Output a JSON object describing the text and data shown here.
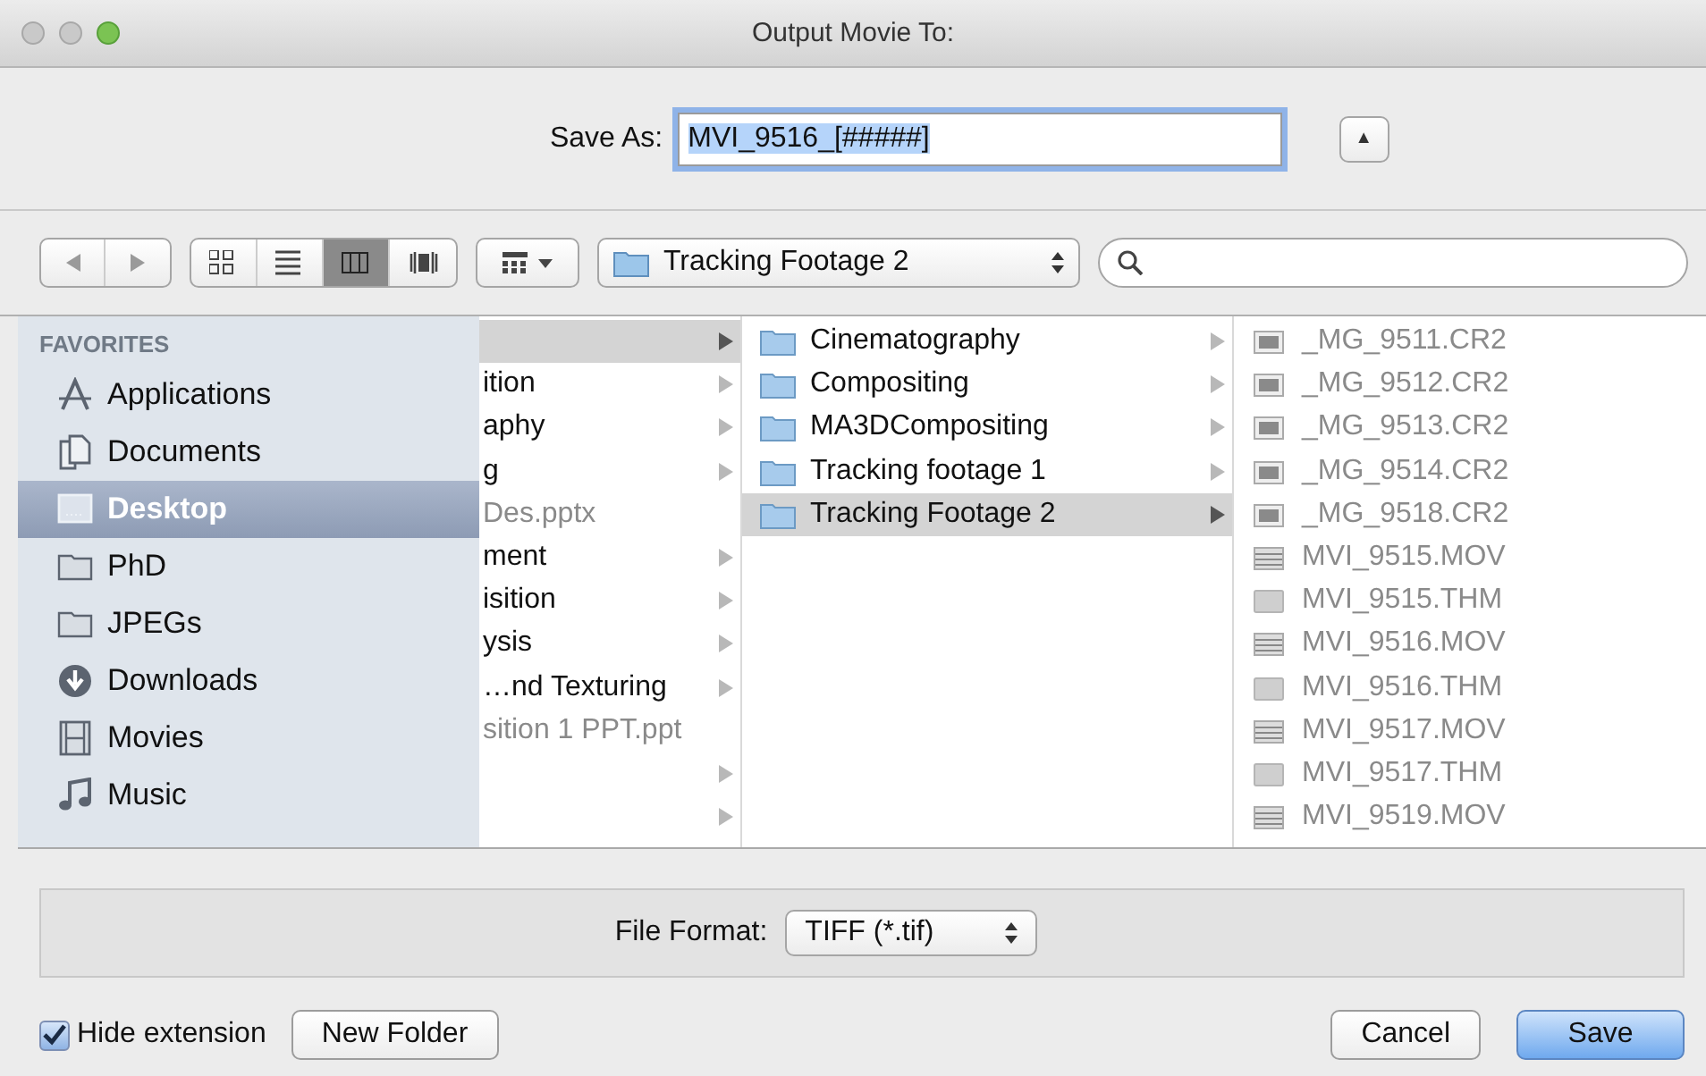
{
  "window": {
    "title": "Output Movie To:"
  },
  "save_as": {
    "label": "Save As:",
    "value": "MVI_9516_[#####]",
    "expand_button": "▲"
  },
  "toolbar": {
    "view_modes": [
      {
        "kind": "icons",
        "selected": false
      },
      {
        "kind": "list",
        "selected": false
      },
      {
        "kind": "columns",
        "selected": true
      },
      {
        "kind": "coverflow",
        "selected": false
      }
    ],
    "location": "Tracking Footage 2"
  },
  "sidebar": {
    "heading": "FAVORITES",
    "items": [
      {
        "label": "Applications",
        "kind": "apps",
        "selected": false
      },
      {
        "label": "Documents",
        "kind": "documents",
        "selected": false
      },
      {
        "label": "Desktop",
        "kind": "desktop",
        "selected": true
      },
      {
        "label": "PhD",
        "kind": "folder",
        "selected": false
      },
      {
        "label": "JPEGs",
        "kind": "folder",
        "selected": false
      },
      {
        "label": "Downloads",
        "kind": "downloads",
        "selected": false
      },
      {
        "label": "Movies",
        "kind": "movies",
        "selected": false
      },
      {
        "label": "Music",
        "kind": "music",
        "selected": false
      }
    ]
  },
  "columns": [
    {
      "items": [
        {
          "has_children": true,
          "selected": true
        },
        {
          "label": "ition",
          "has_children": true,
          "selected": false,
          "disabled": false
        },
        {
          "label": "aphy",
          "has_children": true,
          "selected": false,
          "disabled": false
        },
        {
          "label": "g",
          "has_children": true,
          "selected": false,
          "disabled": false
        },
        {
          "label": "Des.pptx",
          "has_children": false,
          "selected": false,
          "disabled": true
        },
        {
          "label": "ment",
          "has_children": true,
          "selected": false,
          "disabled": false
        },
        {
          "label": "isition",
          "has_children": true,
          "selected": false,
          "disabled": false
        },
        {
          "label": "ysis",
          "has_children": true,
          "selected": false,
          "disabled": false
        },
        {
          "label": "…nd Texturing",
          "has_children": true,
          "selected": false,
          "disabled": false
        },
        {
          "label": "sition 1 PPT.ppt",
          "has_children": false,
          "selected": false,
          "disabled": true
        },
        {
          "has_children": true,
          "selected": false
        },
        {
          "has_children": true,
          "selected": false
        }
      ]
    },
    {
      "items": [
        {
          "label": "Cinematography",
          "kind": "folder",
          "has_children": true,
          "selected": false,
          "disabled": false
        },
        {
          "label": "Compositing",
          "kind": "folder",
          "has_children": true,
          "selected": false,
          "disabled": false
        },
        {
          "label": "MA3DCompositing",
          "kind": "folder",
          "has_children": true,
          "selected": false,
          "disabled": false
        },
        {
          "label": "Tracking footage 1",
          "kind": "folder",
          "has_children": true,
          "selected": false,
          "disabled": false
        },
        {
          "label": "Tracking Footage 2",
          "kind": "folder",
          "has_children": true,
          "selected": true,
          "disabled": false
        }
      ]
    },
    {
      "items": [
        {
          "label": "_MG_9511.CR2",
          "kind": "image",
          "has_children": false,
          "selected": false,
          "disabled": true
        },
        {
          "label": "_MG_9512.CR2",
          "kind": "image",
          "has_children": false,
          "selected": false,
          "disabled": true
        },
        {
          "label": "_MG_9513.CR2",
          "kind": "image",
          "has_children": false,
          "selected": false,
          "disabled": true
        },
        {
          "label": "_MG_9514.CR2",
          "kind": "image",
          "has_children": false,
          "selected": false,
          "disabled": true
        },
        {
          "label": "_MG_9518.CR2",
          "kind": "image",
          "has_children": false,
          "selected": false,
          "disabled": true
        },
        {
          "label": "MVI_9515.MOV",
          "kind": "movie",
          "has_children": false,
          "selected": false,
          "disabled": true
        },
        {
          "label": "MVI_9515.THM",
          "kind": "thumbnail",
          "has_children": false,
          "selected": false,
          "disabled": true
        },
        {
          "label": "MVI_9516.MOV",
          "kind": "movie",
          "has_children": false,
          "selected": false,
          "disabled": true
        },
        {
          "label": "MVI_9516.THM",
          "kind": "thumbnail",
          "has_children": false,
          "selected": false,
          "disabled": true
        },
        {
          "label": "MVI_9517.MOV",
          "kind": "movie",
          "has_children": false,
          "selected": false,
          "disabled": true
        },
        {
          "label": "MVI_9517.THM",
          "kind": "thumbnail",
          "has_children": false,
          "selected": false,
          "disabled": true
        },
        {
          "label": "MVI_9519.MOV",
          "kind": "movie",
          "has_children": false,
          "selected": false,
          "disabled": true
        }
      ]
    }
  ],
  "file_format": {
    "label": "File Format:",
    "value": "TIFF (*.tif)"
  },
  "hide_extension": {
    "label": "Hide extension",
    "checked": true
  },
  "buttons": [
    {
      "label": "New Folder",
      "kind": "secondary"
    },
    {
      "label": "Cancel",
      "kind": "secondary"
    },
    {
      "label": "Save",
      "kind": "default"
    }
  ]
}
